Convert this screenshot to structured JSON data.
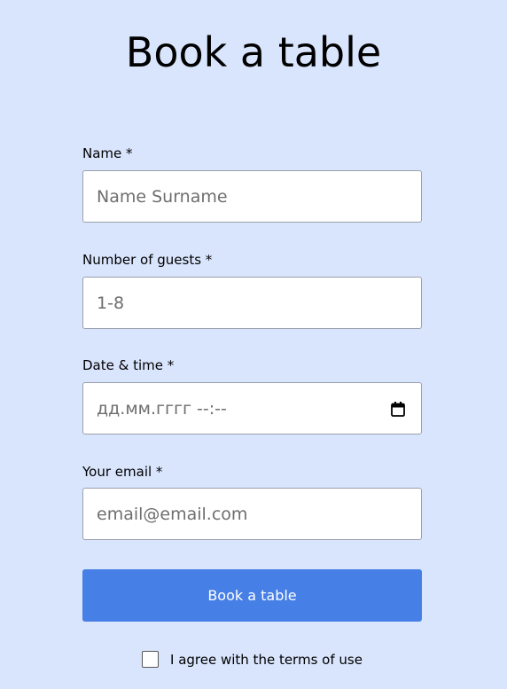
{
  "page": {
    "title": "Book a table"
  },
  "form": {
    "name": {
      "label": "Name *",
      "placeholder": "Name Surname"
    },
    "guests": {
      "label": "Number of guests *",
      "placeholder": "1-8"
    },
    "datetime": {
      "label": "Date & time *",
      "placeholder": "дд.мм.гггг --:--"
    },
    "email": {
      "label": "Your email *",
      "placeholder": "email@email.com"
    },
    "submit_label": "Book a table",
    "terms": {
      "label": "I agree with the terms of use",
      "checked": false
    }
  },
  "colors": {
    "page_background": "#d9e5fd",
    "button_background": "#467fe5",
    "button_text": "#ffffff"
  },
  "icons": {
    "datetime_picker": "calendar-icon"
  }
}
